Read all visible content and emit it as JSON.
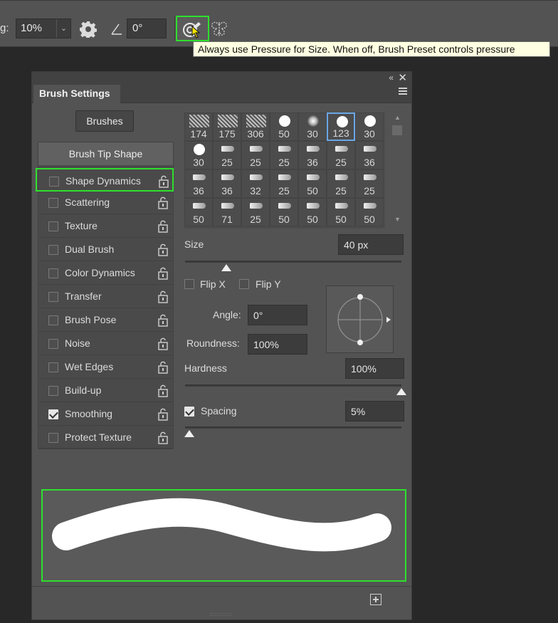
{
  "toolbar": {
    "smoothing_label_partial": "g:",
    "smoothing_value": "10%",
    "angle_value": "0°",
    "tooltip": "Always use Pressure for Size. When off, Brush Preset controls pressure"
  },
  "panel": {
    "tab_title": "Brush Settings",
    "brushes_button": "Brushes",
    "brush_tip_shape": "Brush Tip Shape",
    "options": [
      {
        "label": "Shape Dynamics",
        "checked": false
      },
      {
        "label": "Scattering",
        "checked": false
      },
      {
        "label": "Texture",
        "checked": false
      },
      {
        "label": "Dual Brush",
        "checked": false
      },
      {
        "label": "Color Dynamics",
        "checked": false
      },
      {
        "label": "Transfer",
        "checked": false
      },
      {
        "label": "Brush Pose",
        "checked": false
      },
      {
        "label": "Noise",
        "checked": false
      },
      {
        "label": "Wet Edges",
        "checked": false
      },
      {
        "label": "Build-up",
        "checked": false
      },
      {
        "label": "Smoothing",
        "checked": true
      },
      {
        "label": "Protect Texture",
        "checked": false
      }
    ],
    "brush_sizes": [
      [
        "174",
        "175",
        "306",
        "50",
        "30",
        "123",
        "30"
      ],
      [
        "30",
        "25",
        "25",
        "25",
        "36",
        "25",
        "36"
      ],
      [
        "36",
        "36",
        "32",
        "25",
        "50",
        "25",
        "25"
      ],
      [
        "50",
        "71",
        "25",
        "50",
        "50",
        "50",
        "50"
      ]
    ],
    "size_label": "Size",
    "size_value": "40 px",
    "size_slider_fraction": 0.19,
    "flip_x_label": "Flip X",
    "flip_y_label": "Flip Y",
    "angle_label": "Angle:",
    "angle_value": "0°",
    "roundness_label": "Roundness:",
    "roundness_value": "100%",
    "hardness_label": "Hardness",
    "hardness_value": "100%",
    "hardness_fraction": 1.0,
    "spacing_label": "Spacing",
    "spacing_checked": true,
    "spacing_value": "5%",
    "spacing_fraction": 0.02
  }
}
